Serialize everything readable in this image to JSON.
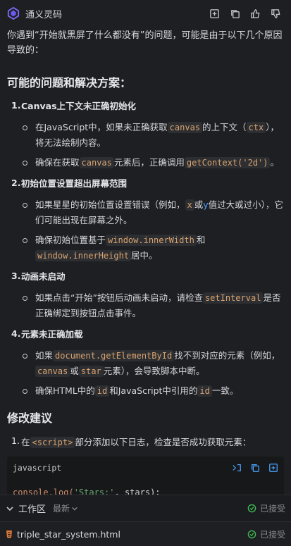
{
  "header": {
    "title": "通义灵码",
    "icons": [
      "insert-icon",
      "copy-icon",
      "thumbs-up-icon",
      "thumbs-down-icon"
    ]
  },
  "intro": "你遇到“开始就黑屏了什么都没有”的问题，可能是由于以下几个原因导致的：",
  "section1": {
    "title": "可能的问题和解决方案：",
    "items": [
      {
        "num": "1.",
        "heading": "Canvas上下文未正确初始化",
        "bullets": [
          {
            "a": "在JavaScript中，如果未正确获取",
            "code1": "canvas",
            "b": "的上下文（",
            "code2": "ctx",
            "c": "），将无法绘制内容。"
          },
          {
            "a": "确保在获取",
            "code1": "canvas",
            "b": "元素后，正确调用",
            "code2": "getContext('2d')",
            "c": "。"
          }
        ]
      },
      {
        "num": "2.",
        "heading": "初始位置设置超出屏幕范围",
        "bullets": [
          {
            "a": "如果星星的初始位置设置错误（例如，",
            "code1": "x",
            "b": "或",
            "y": "y",
            "c": "值过大或过小），它们可能出现在屏幕之外。"
          },
          {
            "a": "确保初始位置基于",
            "code1": "window.innerWidth",
            "b": "和",
            "code2": "window.innerHeight",
            "c": "居中。"
          }
        ]
      },
      {
        "num": "3.",
        "heading": "动画未启动",
        "bullets": [
          {
            "a": "如果点击“开始”按钮后动画未启动，请检查",
            "code1": "setInterval",
            "b": "是否正确绑定到按钮点击事件。"
          }
        ]
      },
      {
        "num": "4.",
        "heading": "元素未正确加载",
        "bullets": [
          {
            "a": "如果",
            "code1": "document.getElementById",
            "b": "找不到对应的元素（例如，",
            "code2": "canvas",
            "c": "或",
            "code3": "star",
            "d": "元素），会导致脚本中断。"
          },
          {
            "a": "确保HTML中的",
            "code1": "id",
            "b": "和JavaScript中引用的",
            "code2": "id",
            "c": "一致。"
          }
        ]
      }
    ]
  },
  "section2": {
    "title": "修改建议",
    "item": {
      "num": "1.",
      "a": "在",
      "code1": "<script>",
      "b": "部分添加以下日志，检查是否成功获取元素："
    },
    "codeblock": {
      "lang": "javascript",
      "line_a": "console.log(",
      "line_str": "'Stars:'",
      "line_b": ", stars);"
    }
  },
  "workbar": {
    "title": "工作区",
    "latest": "最新",
    "status": "已接受"
  },
  "filebar": {
    "file": "triple_star_system.html",
    "status": "已接受"
  },
  "colors": {
    "accent": "#4aa3ff",
    "code": "#d7a36f",
    "success": "#3fb950",
    "bg": "#1e1f22"
  }
}
